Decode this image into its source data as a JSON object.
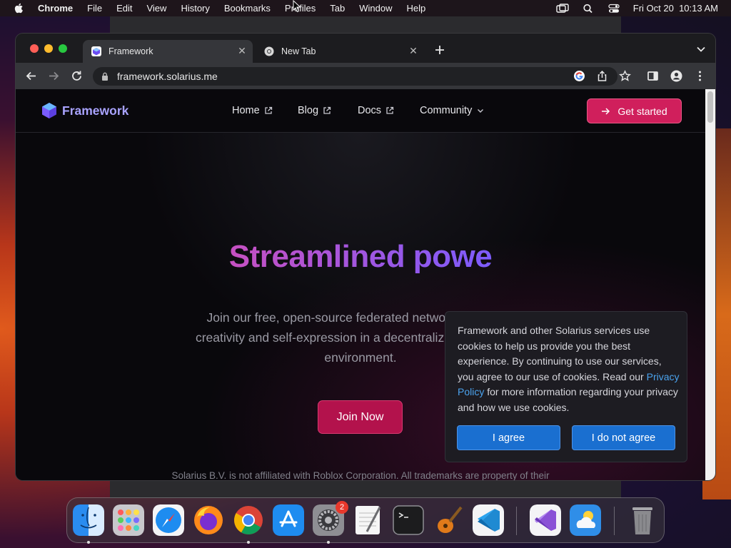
{
  "menubar": {
    "app_name": "Chrome",
    "items": [
      "File",
      "Edit",
      "View",
      "History",
      "Bookmarks",
      "Profiles",
      "Tab",
      "Window",
      "Help"
    ],
    "clock": "Fri Oct 20  10:13 AM"
  },
  "browser": {
    "tabs": [
      {
        "title": "Framework",
        "active": true
      },
      {
        "title": "New Tab",
        "active": false
      }
    ],
    "url": "framework.solarius.me"
  },
  "site": {
    "brand": "Framework",
    "nav": {
      "home": "Home",
      "blog": "Blog",
      "docs": "Docs",
      "community": "Community"
    },
    "cta_label": "Get started",
    "hero_title": "Streamlined powe",
    "hero_subtitle_lines": [
      "Join our free, open-source federated network to explore",
      "creativity and self-expression in a decentralized, censorship",
      "environment."
    ],
    "join_label": "Join Now",
    "footnote": "Solarius B.V. is not affiliated with Roblox Corporation. All trademarks are property of their"
  },
  "cookie_banner": {
    "text_before": "Framework and other Solarius services use cookies to help us provide you the best experience. By continuing to use our services, you agree to our use of cookies. Read our ",
    "link_text": "Privacy Policy",
    "text_after": " for more information regarding your privacy and how we use cookies.",
    "agree_label": "I agree",
    "disagree_label": "I do not agree"
  },
  "dock": {
    "apps": [
      "finder-icon",
      "launchpad-icon",
      "safari-icon",
      "firefox-icon",
      "chrome-icon",
      "app-store-icon",
      "system-settings-icon",
      "textedit-icon",
      "terminal-icon",
      "garageband-icon",
      "vscode-icon",
      "visual-studio-icon",
      "weather-icon",
      "trash-icon"
    ],
    "settings_badge": "2"
  },
  "colors": {
    "accent_pink": "#d01f5c",
    "brand_purple": "#a9a3ff",
    "cookie_button_blue": "#1a6fd0",
    "link_blue": "#4ba3ee"
  }
}
